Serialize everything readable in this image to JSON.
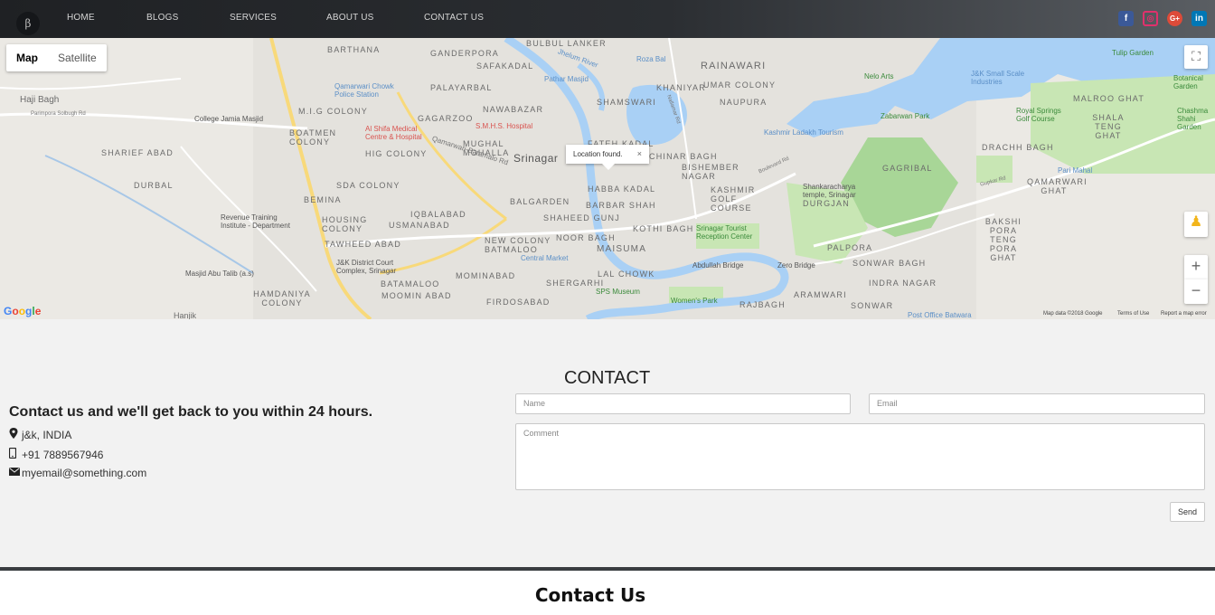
{
  "nav": {
    "logo": "β",
    "links": [
      "HOME",
      "BLOGS",
      "SERVICES",
      "ABOUT US",
      "CONTACT US"
    ],
    "social": [
      {
        "name": "facebook",
        "glyph": "f",
        "color": "#3b5998"
      },
      {
        "name": "instagram",
        "glyph": "◎",
        "color": "#e1306c"
      },
      {
        "name": "google-plus",
        "glyph": "G+",
        "color": "#dd4b39"
      },
      {
        "name": "linkedin",
        "glyph": "in",
        "color": "#0077b5"
      }
    ]
  },
  "map": {
    "type_buttons": {
      "map": "Map",
      "satellite": "Satellite"
    },
    "infowindow_text": "Location found.",
    "infowindow_close": "×",
    "google_logo": "Google",
    "footer": {
      "data": "Map data ©2018 Google",
      "terms": "Terms of Use",
      "report": "Report a map error"
    },
    "labels": [
      "BARTHANA",
      "GANDERPORA",
      "BULBUL LANKER",
      "RAINAWARI",
      "SAFAKADAL",
      "PALAYARBAL",
      "KHANIYAR",
      "UMAR COLONY",
      "NAUPURA",
      "M.I.G COLONY",
      "NAWABAZAR",
      "GAGARZOO",
      "SHAMSWARI",
      "BOATMEN COLONY",
      "MUGHAL MOHALLA",
      "FATEH KADAL",
      "CHINAR BAGH",
      "SHARIEF ABAD",
      "HIG COLONY",
      "Srinagar",
      "BISHEMBER NAGAR",
      "DURBAL",
      "SDA COLONY",
      "HABBA KADAL",
      "KASHMIR GOLF COURSE",
      "BEMINA",
      "BALGARDEN",
      "BARBAR SHAH",
      "IQBALABAD",
      "SHAHEED GUNJ",
      "HOUSING COLONY",
      "USMANABAD",
      "KOTHI BAGH",
      "NOOR BAGH",
      "NEW COLONY BATMALOO",
      "MAISUMA",
      "TAWHEED ABAD",
      "PALPORA",
      "BATAMALOO",
      "MOMINABAD",
      "LAL CHOWK",
      "SONWAR BAGH",
      "SHERGARHI",
      "HAMDANIYA COLONY",
      "MOOMIN ABAD",
      "FIRDOSABAD",
      "ARAMWARI",
      "INDRA NAGAR",
      "RAJBAGH",
      "SONWAR",
      "GAGRIBAL",
      "DRACHH BAGH",
      "MALROO GHAT",
      "SHALA TENG GHAT",
      "QAMARWARI GHAT",
      "BAKSHI PORA TENG PORA GHAT",
      "DURGJAN",
      "Haji Bagh",
      "Hanjik"
    ],
    "pois": [
      "Qamarwari Chowk Police Station",
      "Pathar Masjid",
      "Roza Bal",
      "Nelo Arts",
      "J&K Small Scale Industries",
      "Tulip Garden",
      "Botanical Garden",
      "College Jamia Masjid",
      "Al Shifa Medical Centre & Hospital",
      "S.M.H.S. Hospital",
      "Kashmir Ladakh Tourism",
      "Zabarwan Park",
      "Royal Springs Golf Course",
      "Chashma Shahi Garden",
      "Pari Mahal",
      "Shankaracharya temple, Srinagar",
      "Revenue Training Institute - Department",
      "J&K District Court Complex, Srinagar",
      "Srinagar Tourist Reception Center",
      "Central Market",
      "Abdullah Bridge",
      "Zero Bridge",
      "SPS Museum",
      "Women's Park",
      "Post Office Batwara",
      "Masjid Abu Talib (a.s)"
    ],
    "roads": [
      "Qamarwari-Batamalo Rd",
      "Parimpora Solbugh Rd",
      "Jhelum River",
      "Boulevard Rd",
      "Gupkar Rd",
      "Nallamar Rd"
    ]
  },
  "contact": {
    "title": "CONTACT",
    "tagline": "Contact us and we'll get back to you within 24 hours.",
    "address": "j&k, INDIA",
    "phone": "+91 7889567946",
    "email": "myemail@something.com",
    "form": {
      "name_placeholder": "Name",
      "email_placeholder": "Email",
      "comment_placeholder": "Comment",
      "send_label": "Send"
    }
  },
  "caption": "Contact Us"
}
